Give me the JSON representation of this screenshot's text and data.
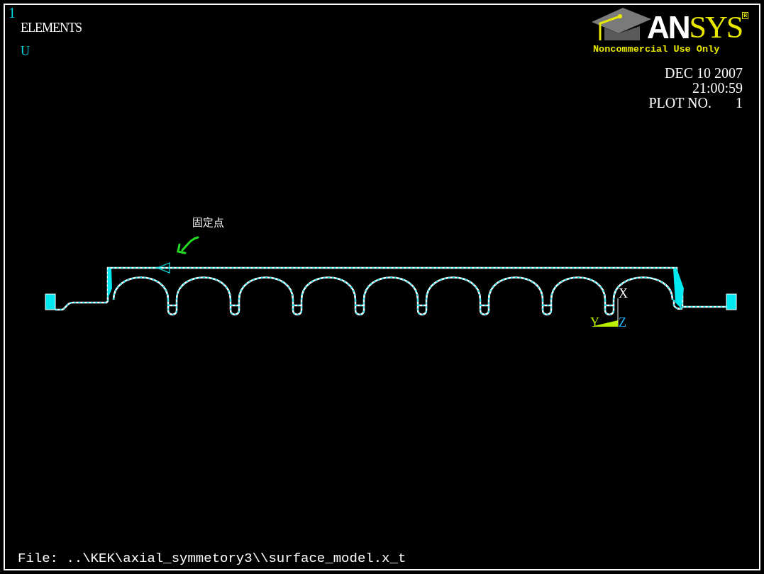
{
  "window_number": "1",
  "plot_label": "ELEMENTS",
  "display_label": "U",
  "logo": {
    "parts": [
      {
        "text": "AN",
        "color": "#ffffff"
      },
      {
        "text": "SYS",
        "color": "#e8e800"
      }
    ],
    "mark": "R",
    "notice": "Noncommercial Use Only"
  },
  "date": "DEC 10 2007",
  "time": "21:00:59",
  "plot_no": {
    "label": "PLOT NO.",
    "value": "1"
  },
  "annotation": "固定点",
  "axes": [
    {
      "label": "X",
      "color": "#ffffff"
    },
    {
      "label": "Y",
      "color": "#b8f000"
    },
    {
      "label": "Z",
      "color": "#1eb4ff"
    }
  ],
  "file_line": "File: ..\\KEK\\axial_symmetory3\\\\surface_model.x_t"
}
